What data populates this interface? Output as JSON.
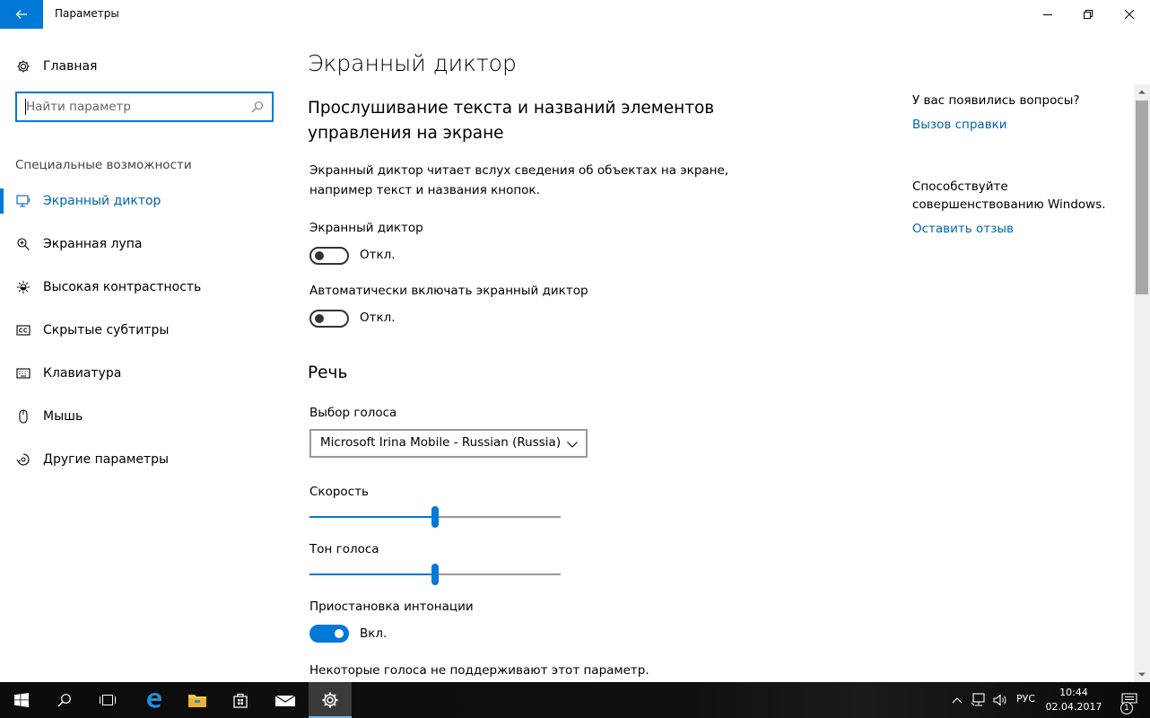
{
  "window": {
    "title": "Параметры"
  },
  "sidebar": {
    "home_label": "Главная",
    "search_placeholder": "Найти параметр",
    "section_label": "Специальные возможности",
    "items": [
      {
        "label": "Экранный диктор",
        "icon": "narrator-icon",
        "active": true
      },
      {
        "label": "Экранная лупа",
        "icon": "magnifier-icon",
        "active": false
      },
      {
        "label": "Высокая контрастность",
        "icon": "high-contrast-icon",
        "active": false
      },
      {
        "label": "Скрытые субтитры",
        "icon": "closed-captions-icon",
        "active": false
      },
      {
        "label": "Клавиатура",
        "icon": "keyboard-icon",
        "active": false
      },
      {
        "label": "Мышь",
        "icon": "mouse-icon",
        "active": false
      },
      {
        "label": "Другие параметры",
        "icon": "other-options-icon",
        "active": false
      }
    ]
  },
  "main": {
    "title": "Экранный диктор",
    "subheading": "Прослушивание текста и названий элементов управления на экране",
    "description": "Экранный диктор читает вслух сведения об объектах на экране, например текст и названия кнопок.",
    "narrator_toggle": {
      "label": "Экранный диктор",
      "state": "Откл.",
      "on": false
    },
    "auto_start_toggle": {
      "label": "Автоматически включать экранный диктор",
      "state": "Откл.",
      "on": false
    },
    "speech_title": "Речь",
    "voice": {
      "label": "Выбор голоса",
      "selected": "Microsoft Irina Mobile - Russian (Russia)"
    },
    "speed": {
      "label": "Скорость",
      "value_fraction": 0.5
    },
    "pitch": {
      "label": "Тон голоса",
      "value_fraction": 0.5
    },
    "intonation_toggle": {
      "label": "Приостановка интонации",
      "state": "Вкл.",
      "on": true
    },
    "note": "Некоторые голоса не поддерживают этот параметр."
  },
  "right": {
    "question": "У вас появились вопросы?",
    "help_link": "Вызов справки",
    "feedback_text": "Способствуйте совершенствованию Windows.",
    "feedback_link": "Оставить отзыв"
  },
  "taskbar": {
    "language": "РУС",
    "time": "10:44",
    "date": "02.04.2017",
    "notification_count": "1"
  },
  "colors": {
    "accent": "#0078d7",
    "link": "#0063b1",
    "taskbar": "#101010"
  }
}
